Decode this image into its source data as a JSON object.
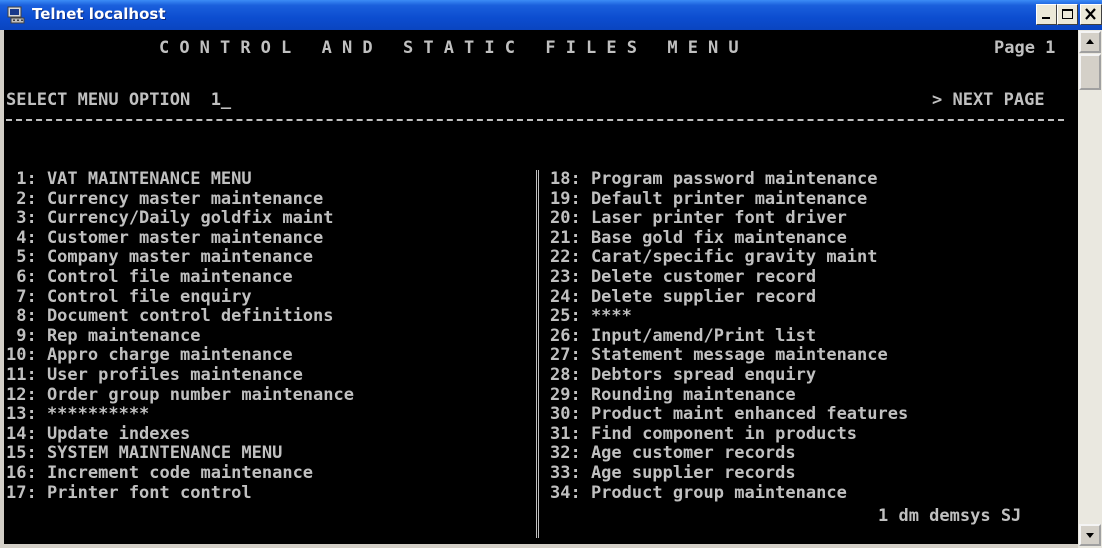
{
  "window": {
    "title": "Telnet localhost"
  },
  "colors": {
    "terminal_background": "#000000",
    "terminal_text": "#c0c0c0",
    "titlebar": "#0c4dd0"
  },
  "icons": {
    "app": "telnet-terminal-icon",
    "minimize": "minimize-icon",
    "maximize": "maximize-icon",
    "close": "close-icon",
    "scroll_up": "arrow-up-icon",
    "scroll_down": "arrow-down-icon"
  },
  "screen": {
    "heading": "CONTROL AND STATIC FILES MENU",
    "page_label": "Page 1",
    "prompt": "SELECT MENU OPTION  1_",
    "next_page": "> NEXT PAGE",
    "left_items": [
      " 1: VAT MAINTENANCE MENU",
      " 2: Currency master maintenance",
      " 3: Currency/Daily goldfix maint",
      " 4: Customer master maintenance",
      " 5: Company master maintenance",
      " 6: Control file maintenance",
      " 7: Control file enquiry",
      " 8: Document control definitions",
      " 9: Rep maintenance",
      "10: Appro charge maintenance",
      "11: User profiles maintenance",
      "12: Order group number maintenance",
      "13: **********",
      "14: Update indexes",
      "15: SYSTEM MAINTENANCE MENU",
      "16: Increment code maintenance",
      "17: Printer font control"
    ],
    "right_items": [
      "18: Program password maintenance",
      "19: Default printer maintenance",
      "20: Laser printer font driver",
      "21: Base gold fix maintenance",
      "22: Carat/specific gravity maint",
      "23: Delete customer record",
      "24: Delete supplier record",
      "25: ****",
      "26: Input/amend/Print list",
      "27: Statement message maintenance",
      "28: Debtors spread enquiry",
      "29: Rounding maintenance",
      "30: Product maint enhanced features",
      "31: Find component in products",
      "32: Age customer records",
      "33: Age supplier records",
      "34: Product group maintenance"
    ],
    "status_line": "1 dm demsys SJ"
  }
}
